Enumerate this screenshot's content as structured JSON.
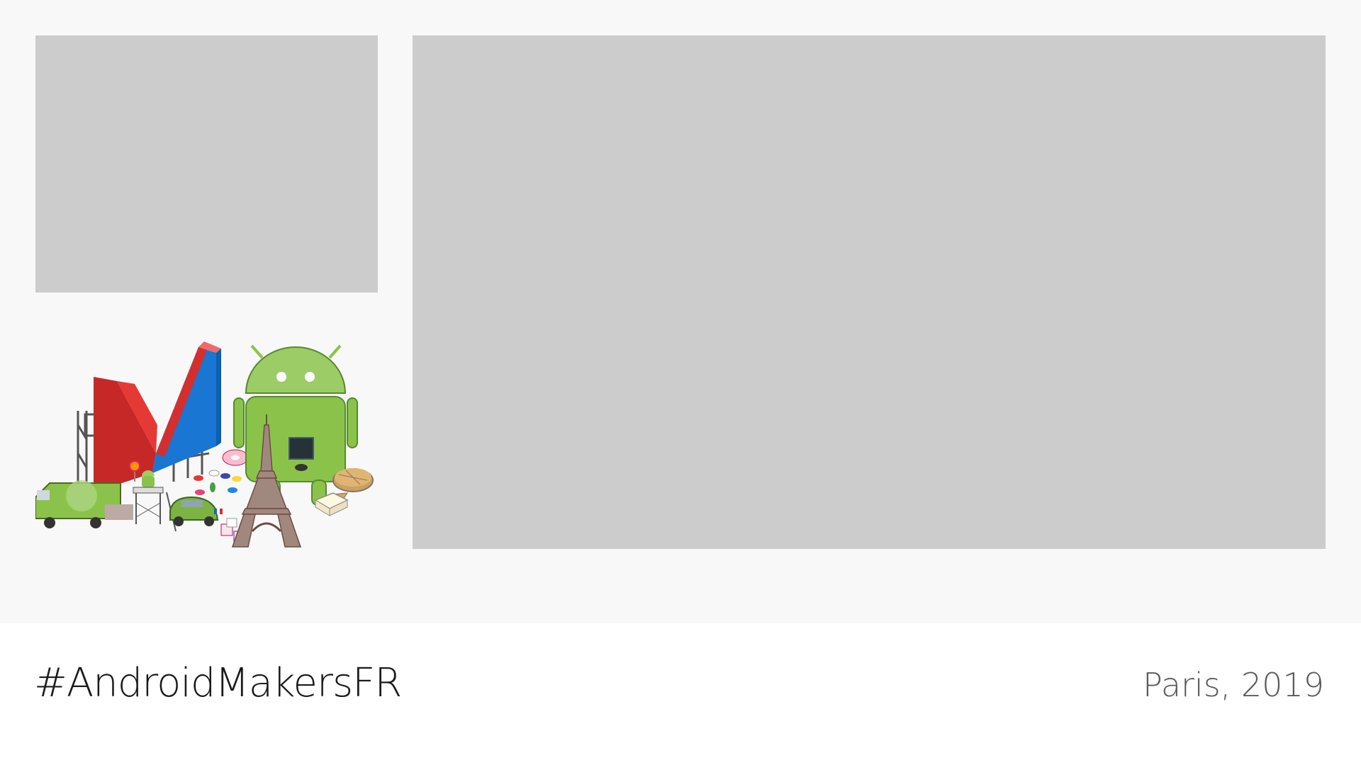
{
  "footer": {
    "hashtag": "#AndroidMakersFR",
    "location": "Paris, 2019"
  },
  "colors": {
    "stage_background": "#f8f8f8",
    "placeholder": "#cccccc",
    "android_green": "#8bc34a",
    "logo_red": "#d32f2f",
    "logo_blue": "#1976d2"
  },
  "illustration": {
    "icons": [
      "makers-m-logo-icon",
      "android-robot-icon",
      "eiffel-tower-icon",
      "van-icon",
      "car-icon",
      "donut-icon",
      "pie-icon",
      "jelly-beans-icon",
      "lollipop-icon",
      "marshmallow-icon"
    ]
  }
}
